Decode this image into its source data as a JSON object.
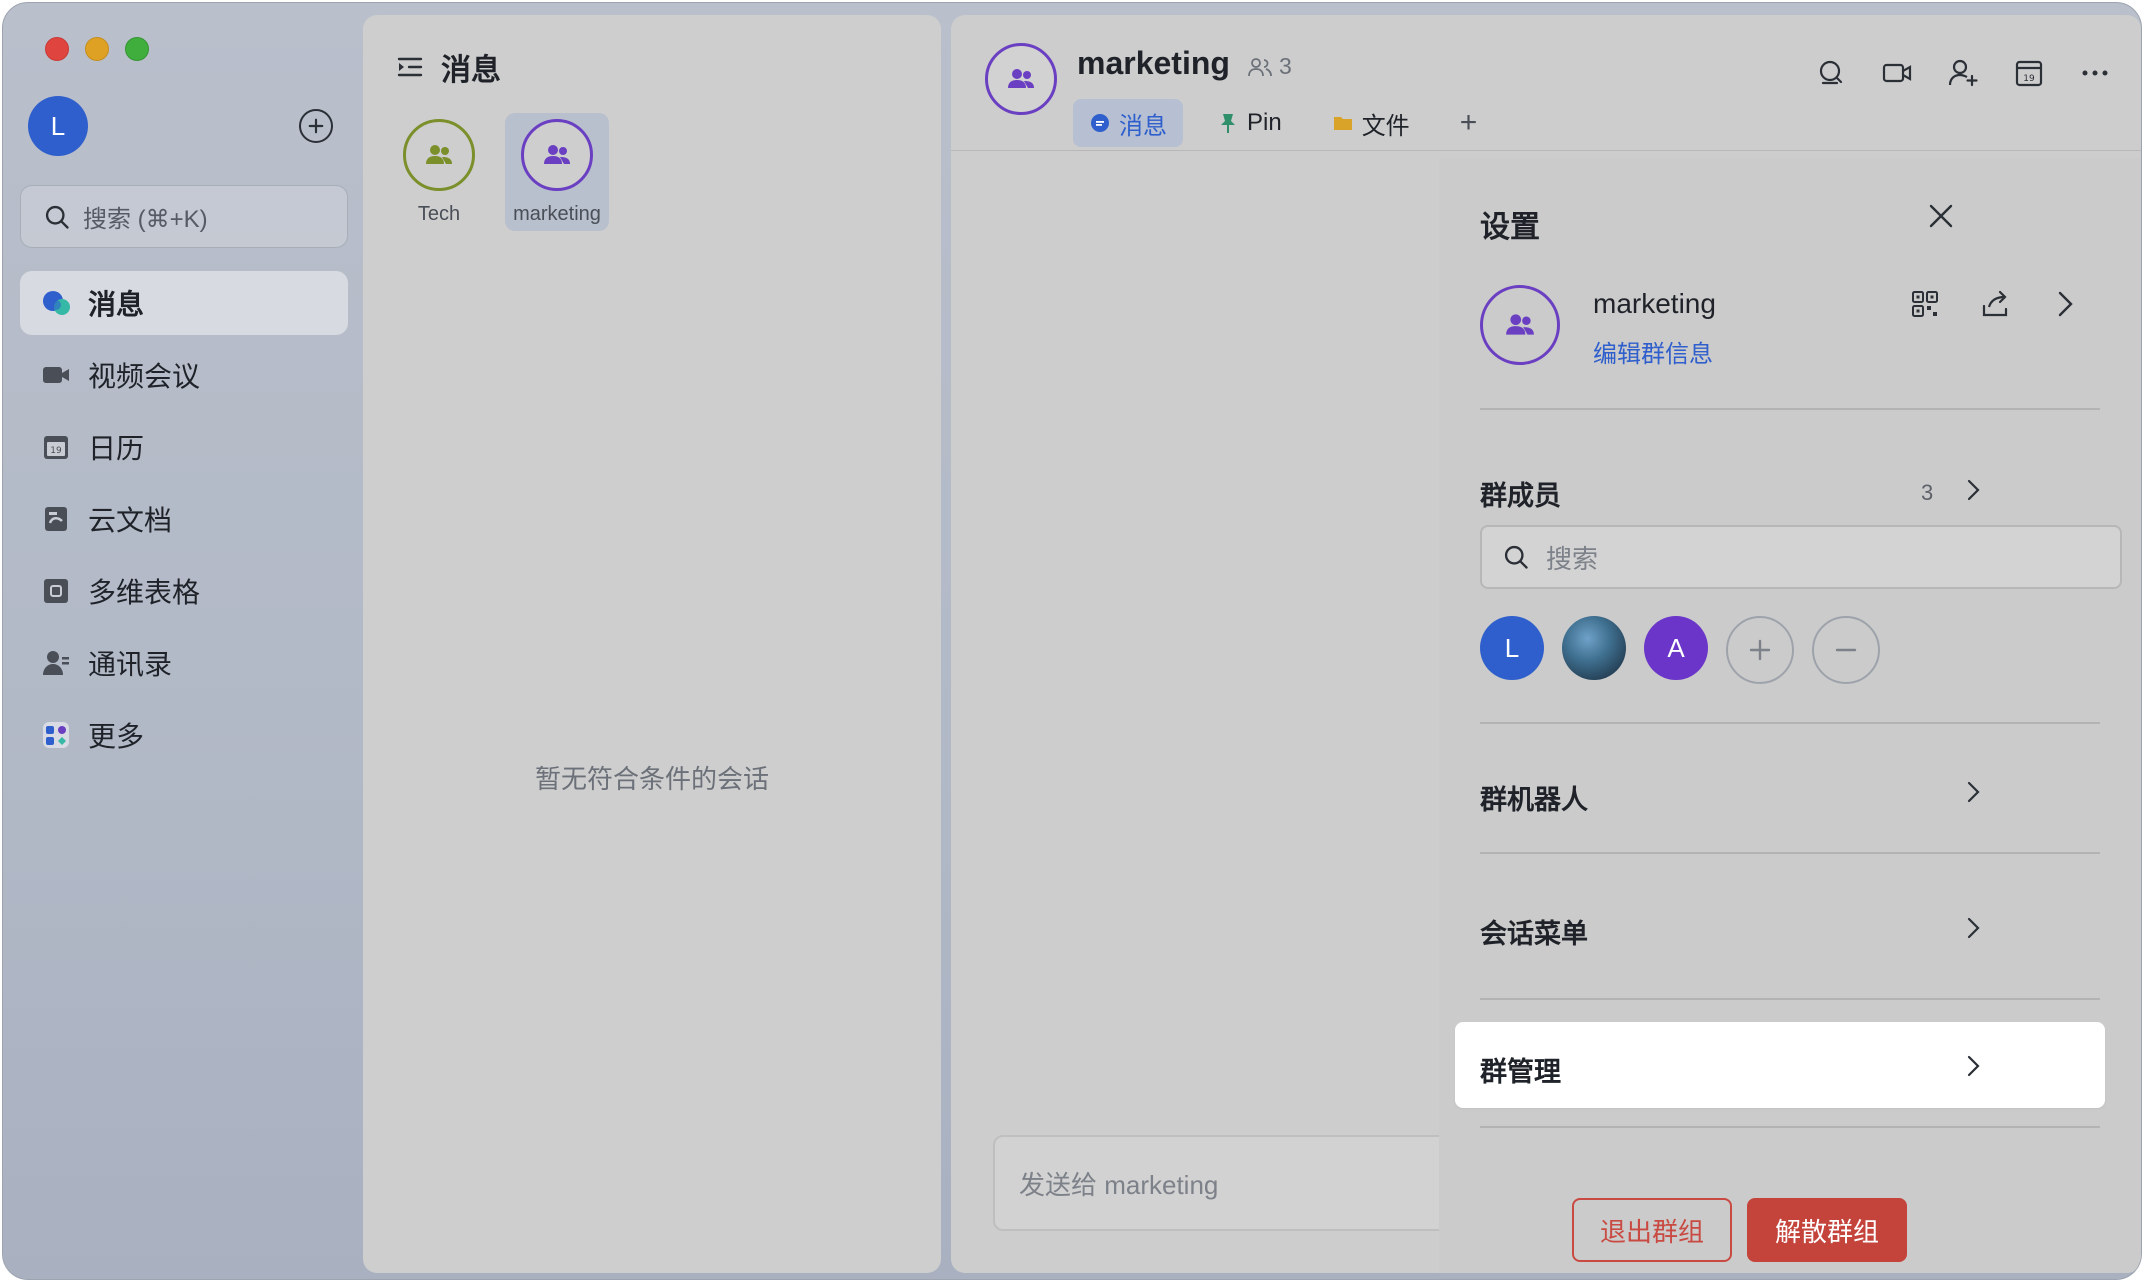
{
  "sidebar": {
    "user_initial": "L",
    "search_placeholder": "搜索 (⌘+K)",
    "items": [
      {
        "label": "消息",
        "icon": "chat-bubble-icon",
        "active": true
      },
      {
        "label": "视频会议",
        "icon": "video-camera-icon"
      },
      {
        "label": "日历",
        "icon": "calendar-icon"
      },
      {
        "label": "云文档",
        "icon": "cloud-doc-icon"
      },
      {
        "label": "多维表格",
        "icon": "base-table-icon"
      },
      {
        "label": "通讯录",
        "icon": "contacts-icon"
      },
      {
        "label": "更多",
        "icon": "more-apps-icon"
      }
    ]
  },
  "middle": {
    "title": "消息",
    "chats": [
      {
        "label": "Tech",
        "ring_color": "#7b8f2b"
      },
      {
        "label": "marketing",
        "ring_color": "#6a3fc2",
        "active": true
      }
    ],
    "empty_text": "暂无符合条件的会话"
  },
  "chat": {
    "title": "marketing",
    "member_count": "3",
    "tabs": [
      {
        "label": "消息",
        "icon": "chat-bubble-icon",
        "active": true
      },
      {
        "label": "Pin",
        "icon": "pin-icon"
      },
      {
        "label": "文件",
        "icon": "folder-icon"
      }
    ],
    "add_tab": "+",
    "composer_placeholder": "发送给 marketing"
  },
  "settings": {
    "title": "设置",
    "group_name": "marketing",
    "edit_info": "编辑群信息",
    "members_title": "群成员",
    "members_count": "3",
    "member_search_placeholder": "搜索",
    "members": [
      {
        "initial": "L",
        "color": "#2f5fcc"
      },
      {
        "initial": "",
        "kind": "photo"
      },
      {
        "initial": "A",
        "color": "#6a35c8"
      }
    ],
    "bots_title": "群机器人",
    "menu_title": "会话菜单",
    "manage_title": "群管理",
    "leave_label": "退出群组",
    "dissolve_label": "解散群组"
  },
  "colors": {
    "accent": "#2f5fcc",
    "group_ring": "#6a3fc2",
    "danger": "#c4433b"
  }
}
